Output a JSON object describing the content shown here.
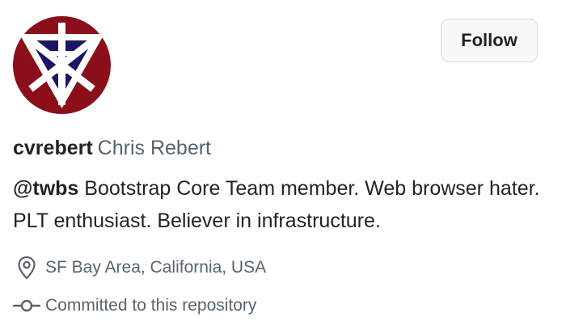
{
  "profile": {
    "login": "cvrebert",
    "full_name": "Chris Rebert",
    "bio_mention": "@twbs",
    "bio_text": " Bootstrap Core Team member. Web browser hater. PLT enthusiast. Believer in infrastructure.",
    "location": "SF Bay Area, California, USA",
    "repo_status": "Committed to this repository"
  },
  "actions": {
    "follow_label": "Follow"
  },
  "icons": {
    "avatar": "triangle-star-logo-avatar",
    "location": "location-pin-icon",
    "commit": "git-commit-icon"
  },
  "colors": {
    "avatar_bg": "#8b0f1a",
    "avatar_accent": "#1b1464",
    "text_primary": "#1f2328",
    "text_muted": "#59636e",
    "button_bg": "#f6f8fa",
    "button_border": "#d1d9e0"
  }
}
